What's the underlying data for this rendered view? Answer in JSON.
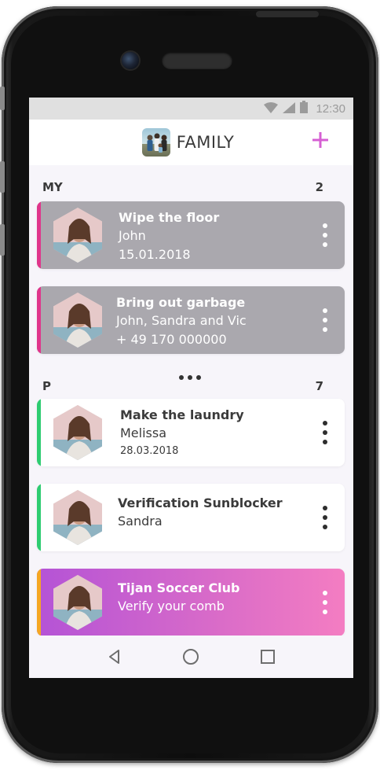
{
  "status_bar": {
    "time": "12:30",
    "icons": [
      "wifi-icon",
      "signal-icon",
      "battery-icon"
    ]
  },
  "header": {
    "title": "FAMILY",
    "add_icon": "plus-icon",
    "accent_color": "#d65fd3"
  },
  "sections": {
    "my": {
      "label": "MY",
      "count": "2"
    },
    "p": {
      "label": "P",
      "count": "7"
    }
  },
  "cards": [
    {
      "title": "Wipe the floor",
      "line1": "John",
      "line2": "15.01.2018",
      "stripe_color": "#e0358b",
      "style": "grey"
    },
    {
      "title": "Bring out garbage",
      "line1": "John, Sandra and Vic",
      "line2": "+ 49 170 000000",
      "stripe_color": "#e0358b",
      "style": "grey"
    },
    {
      "title": "Make the laundry",
      "line1": "Melissa",
      "line2": "28.03.2018",
      "stripe_color": "#2ecc71",
      "style": "white"
    },
    {
      "title": "Verification Sunblocker",
      "line1": "Sandra",
      "stripe_color": "#2ecc71",
      "style": "white"
    },
    {
      "title": "Tijan Soccer Club",
      "line1": "Verify your comb",
      "stripe_color": "#f5a623",
      "style": "gradient"
    }
  ],
  "nav": {
    "back_icon": "back-triangle-icon",
    "home_icon": "home-circle-icon",
    "recents_icon": "recents-square-icon"
  }
}
